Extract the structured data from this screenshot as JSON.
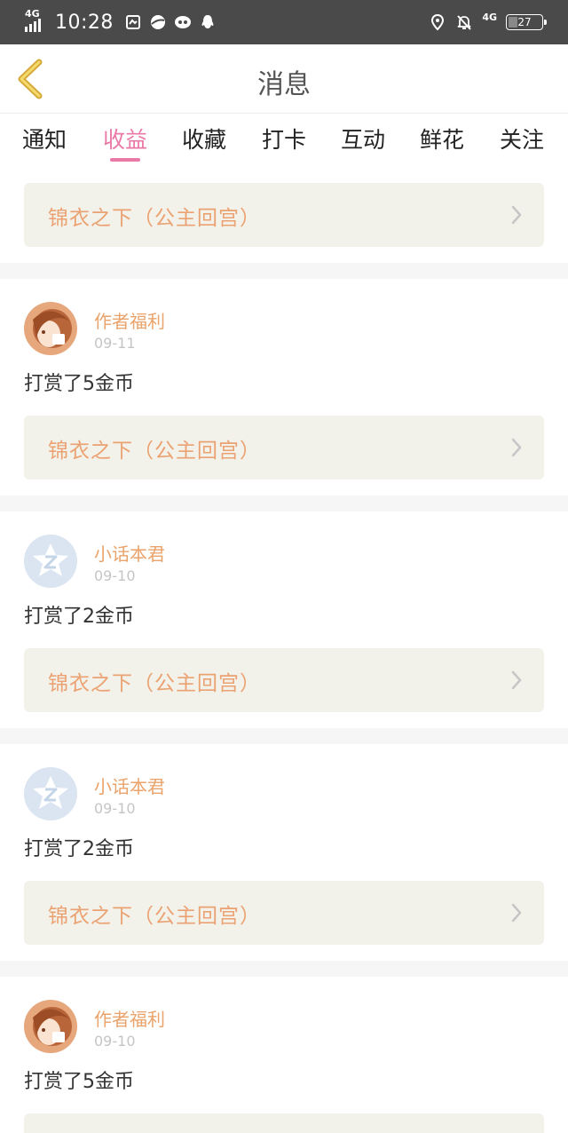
{
  "status_bar": {
    "network_left": "4G",
    "time": "10:28",
    "network_right": "4G",
    "battery": "27"
  },
  "header": {
    "title": "消息",
    "back_icon": "chevron-left-icon"
  },
  "tabs": [
    {
      "label": "通知",
      "active": false
    },
    {
      "label": "收益",
      "active": true
    },
    {
      "label": "收藏",
      "active": false
    },
    {
      "label": "打卡",
      "active": false
    },
    {
      "label": "互动",
      "active": false
    },
    {
      "label": "鲜花",
      "active": false
    },
    {
      "label": "关注",
      "active": false
    }
  ],
  "top_card": {
    "book_title": "锦衣之下（公主回宫）"
  },
  "entries": [
    {
      "user": "作者福利",
      "date": "09-11",
      "text": "打赏了5金币",
      "book_title": "锦衣之下（公主回宫）",
      "avatar": "anime-girl-avatar"
    },
    {
      "user": "小话本君",
      "date": "09-10",
      "text": "打赏了2金币",
      "book_title": "锦衣之下（公主回宫）",
      "avatar": "default-z-avatar"
    },
    {
      "user": "小话本君",
      "date": "09-10",
      "text": "打赏了2金币",
      "book_title": "锦衣之下（公主回宫）",
      "avatar": "default-z-avatar"
    },
    {
      "user": "作者福利",
      "date": "09-10",
      "text": "打赏了5金币",
      "book_title": "",
      "avatar": "anime-girl-avatar"
    }
  ],
  "colors": {
    "accent": "#e979a7",
    "username": "#e9a36b",
    "book_title": "#eba272",
    "book_bg": "#f3f2ea"
  }
}
